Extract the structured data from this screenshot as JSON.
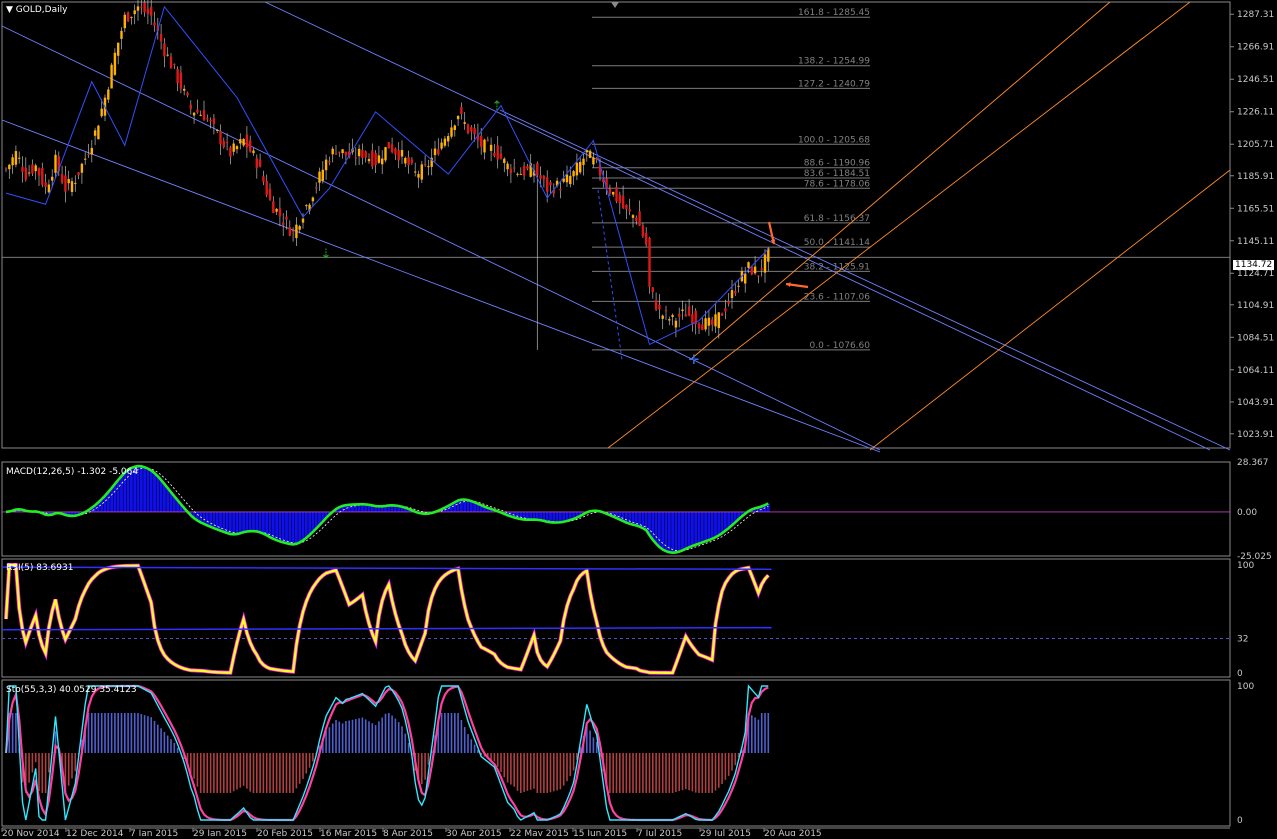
{
  "instrument": {
    "symbol_label": "GOLD,Daily"
  },
  "current_price": "1134.72",
  "main_price_axis": [
    "1287.31",
    "1266.91",
    "1246.51",
    "1226.11",
    "1205.71",
    "1185.91",
    "1165.51",
    "1145.11",
    "1124.71",
    "1104.91",
    "1084.51",
    "1064.11",
    "1043.91",
    "1023.91"
  ],
  "fibo_levels": [
    {
      "label": "161.8 - 1285.45",
      "value": 1285.45
    },
    {
      "label": "138.2 - 1254.99",
      "value": 1254.99
    },
    {
      "label": "127.2 - 1240.79",
      "value": 1240.79
    },
    {
      "label": "100.0 - 1205.68",
      "value": 1205.68
    },
    {
      "label": "88.6 - 1190.96",
      "value": 1190.96
    },
    {
      "label": "83.6 - 1184.51",
      "value": 1184.51
    },
    {
      "label": "78.6 - 1178.06",
      "value": 1178.06
    },
    {
      "label": "61.8 - 1156.37",
      "value": 1156.37
    },
    {
      "label": "50.0 - 1141.14",
      "value": 1141.14
    },
    {
      "label": "38.2 - 1125.91",
      "value": 1125.91
    },
    {
      "label": "23.6 - 1107.06",
      "value": 1107.06
    },
    {
      "label": "0.0 - 1076.60",
      "value": 1076.6
    }
  ],
  "x_axis_labels": [
    "20 Nov 2014",
    "12 Dec 2014",
    "7 Jan 2015",
    "29 Jan 2015",
    "20 Feb 2015",
    "16 Mar 2015",
    "8 Apr 2015",
    "30 Apr 2015",
    "22 May 2015",
    "15 Jun 2015",
    "7 Jul 2015",
    "29 Jul 2015",
    "20 Aug 2015"
  ],
  "indicators": {
    "macd": {
      "label": "MACD(12,26,5) -1.302 -5.064",
      "axis": [
        "28.367",
        "0.00",
        "-25.025"
      ]
    },
    "rsi": {
      "label": "RSI(5) 83.6931",
      "axis": [
        "100",
        "32",
        "0"
      ]
    },
    "stoch": {
      "label": "Sto(55,3,3) 40.0529 35.4123",
      "axis": [
        "100",
        "0"
      ]
    }
  },
  "colors": {
    "candle_up": "#ffb000",
    "candle_down": "#e01818",
    "zigzag": "#3050ff",
    "channel_blue": "#7080ff",
    "channel_orange": "#ff8a2a",
    "macd_line": "#22ee22",
    "macd_hist": "#1010ee",
    "rsi_line": "#ffff20",
    "rsi_shadow": "#ff20ff",
    "stoch_main": "#30e8ff",
    "stoch_signal": "#ff40a0",
    "grid": "#7c7c7c",
    "arrow_orange": "#ff6a2a",
    "arrow_green": "#22aa22",
    "arrow_blue": "#3070ff"
  },
  "chart_data": [
    {
      "type": "candlestick",
      "title": "GOLD,Daily",
      "x": [
        "20 Nov 2014",
        "12 Dec 2014",
        "7 Jan 2015",
        "29 Jan 2015",
        "20 Feb 2015",
        "16 Mar 2015",
        "8 Apr 2015",
        "30 Apr 2015",
        "22 May 2015",
        "15 Jun 2015",
        "7 Jul 2015",
        "29 Jul 2015",
        "20 Aug 2015"
      ],
      "ylim": [
        1015,
        1295
      ],
      "close_path": [
        [
          0,
          1190
        ],
        [
          3,
          1200
        ],
        [
          6,
          1187
        ],
        [
          9,
          1192
        ],
        [
          12,
          1178
        ],
        [
          15,
          1195
        ],
        [
          18,
          1178
        ],
        [
          21,
          1184
        ],
        [
          24,
          1197
        ],
        [
          27,
          1213
        ],
        [
          30,
          1235
        ],
        [
          33,
          1262
        ],
        [
          36,
          1285
        ],
        [
          40,
          1292
        ],
        [
          44,
          1286
        ],
        [
          48,
          1265
        ],
        [
          52,
          1247
        ],
        [
          56,
          1228
        ],
        [
          60,
          1224
        ],
        [
          64,
          1212
        ],
        [
          68,
          1200
        ],
        [
          72,
          1208
        ],
        [
          76,
          1195
        ],
        [
          80,
          1170
        ],
        [
          84,
          1158
        ],
        [
          87,
          1150
        ],
        [
          90,
          1163
        ],
        [
          94,
          1180
        ],
        [
          97,
          1195
        ],
        [
          100,
          1203
        ],
        [
          104,
          1198
        ],
        [
          108,
          1200
        ],
        [
          112,
          1195
        ],
        [
          116,
          1205
        ],
        [
          120,
          1198
        ],
        [
          124,
          1187
        ],
        [
          127,
          1190
        ],
        [
          130,
          1200
        ],
        [
          134,
          1214
        ],
        [
          137,
          1225
        ],
        [
          140,
          1215
        ],
        [
          144,
          1205
        ],
        [
          148,
          1202
        ],
        [
          152,
          1192
        ],
        [
          156,
          1188
        ],
        [
          160,
          1190
        ],
        [
          164,
          1178
        ],
        [
          168,
          1180
        ],
        [
          172,
          1187
        ],
        [
          176,
          1200
        ],
        [
          179,
          1192
        ],
        [
          182,
          1180
        ],
        [
          185,
          1172
        ],
        [
          188,
          1163
        ],
        [
          191,
          1160
        ],
        [
          194,
          1143
        ],
        [
          195,
          1115
        ],
        [
          198,
          1100
        ],
        [
          202,
          1095
        ],
        [
          206,
          1100
        ],
        [
          210,
          1094
        ],
        [
          214,
          1092
        ],
        [
          216,
          1097
        ],
        [
          219,
          1107
        ],
        [
          222,
          1120
        ],
        [
          225,
          1128
        ],
        [
          228,
          1125
        ],
        [
          231,
          1136
        ]
      ],
      "extremes": [
        {
          "x": 40,
          "high": 1298
        },
        {
          "x": 161,
          "low": 1076.6
        },
        {
          "x": 231,
          "high": 1141
        }
      ]
    },
    {
      "type": "line",
      "name": "MACD(12,26,5)",
      "values_last": [
        -1.302,
        -5.064
      ],
      "ylim": [
        -25.025,
        28.367
      ]
    },
    {
      "type": "line",
      "name": "RSI(5)",
      "values_last": [
        83.6931
      ],
      "ylim": [
        0,
        100
      ],
      "level": 32
    },
    {
      "type": "line",
      "name": "Sto(55,3,3)",
      "values_last": [
        40.0529,
        35.4123
      ],
      "ylim": [
        0,
        100
      ]
    }
  ]
}
